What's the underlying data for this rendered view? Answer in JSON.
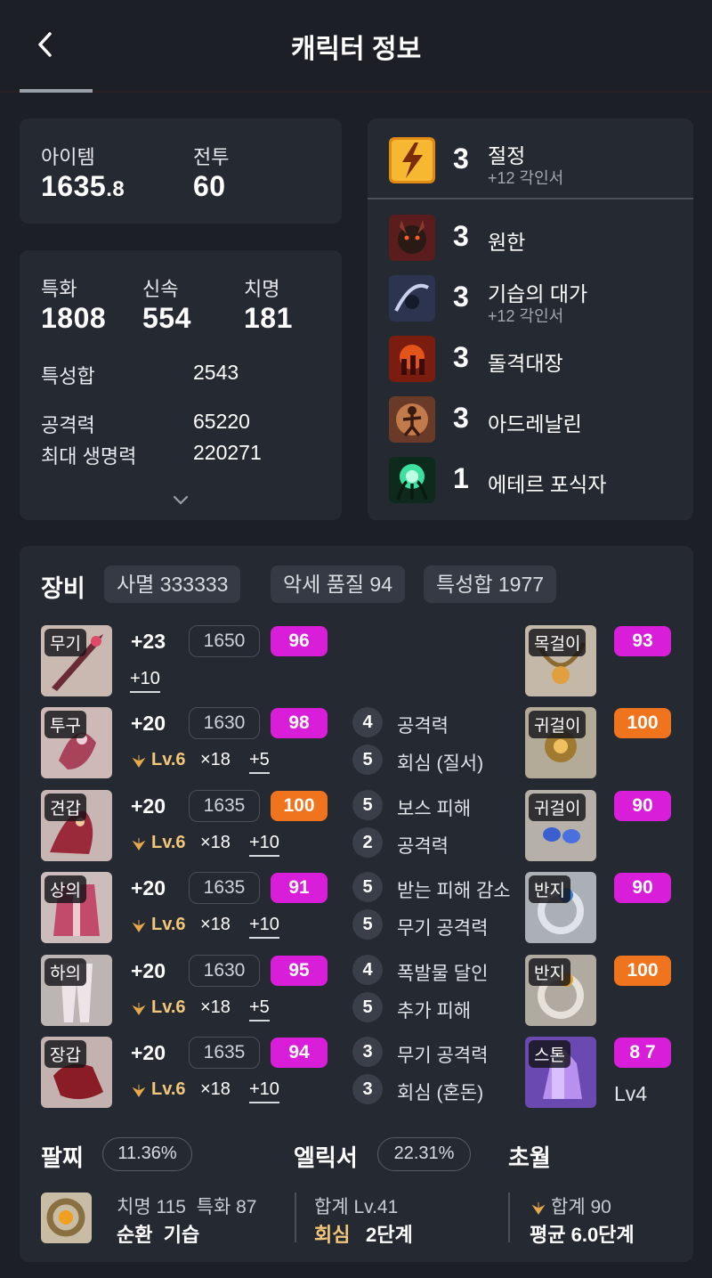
{
  "header": {
    "title": "캐릭터 정보"
  },
  "summary": {
    "item_label": "아이템",
    "item_level_main": "1635",
    "item_level_dec": ".8",
    "combat_label": "전투",
    "combat_level": "60"
  },
  "stats": {
    "crit_special": {
      "label": "특화",
      "value": "1808"
    },
    "swiftness": {
      "label": "신속",
      "value": "554"
    },
    "crit": {
      "label": "치명",
      "value": "181"
    },
    "total_label": "특성합",
    "total_value": "2543",
    "attack_label": "공격력",
    "attack_value": "65220",
    "hp_label": "최대 생명력",
    "hp_value": "220271"
  },
  "engravings": [
    {
      "level": "3",
      "name": "절정",
      "sub": "+12 각인서"
    },
    {
      "level": "3",
      "name": "원한",
      "sub": ""
    },
    {
      "level": "3",
      "name": "기습의 대가",
      "sub": "+12 각인서"
    },
    {
      "level": "3",
      "name": "돌격대장",
      "sub": ""
    },
    {
      "level": "3",
      "name": "아드레날린",
      "sub": ""
    },
    {
      "level": "1",
      "name": "에테르 포식자",
      "sub": ""
    }
  ],
  "equipment": {
    "title": "장비",
    "chips": [
      "사멸 333333",
      "악세 품질 94",
      "특성합 1977"
    ],
    "gear": [
      {
        "tag": "무기",
        "hone": "+23",
        "ilvl": "1650",
        "quality": "96",
        "lv": "",
        "mult": "",
        "plus": "+10"
      },
      {
        "tag": "투구",
        "hone": "+20",
        "ilvl": "1630",
        "quality": "98",
        "lv": "Lv.6",
        "mult": "×18",
        "plus": "+5"
      },
      {
        "tag": "견갑",
        "hone": "+20",
        "ilvl": "1635",
        "quality": "100",
        "lv": "Lv.6",
        "mult": "×18",
        "plus": "+10"
      },
      {
        "tag": "상의",
        "hone": "+20",
        "ilvl": "1635",
        "quality": "91",
        "lv": "Lv.6",
        "mult": "×18",
        "plus": "+10"
      },
      {
        "tag": "하의",
        "hone": "+20",
        "ilvl": "1630",
        "quality": "95",
        "lv": "Lv.6",
        "mult": "×18",
        "plus": "+5"
      },
      {
        "tag": "장갑",
        "hone": "+20",
        "ilvl": "1635",
        "quality": "94",
        "lv": "Lv.6",
        "mult": "×18",
        "plus": "+10"
      }
    ],
    "engrave_stats": [
      {
        "n": "4",
        "name": "공격력"
      },
      {
        "n": "5",
        "name": "회심 (질서)"
      },
      {
        "n": "5",
        "name": "보스 피해"
      },
      {
        "n": "2",
        "name": "공격력"
      },
      {
        "n": "5",
        "name": "받는 피해 감소"
      },
      {
        "n": "5",
        "name": "무기 공격력"
      },
      {
        "n": "4",
        "name": "폭발물 달인"
      },
      {
        "n": "5",
        "name": "추가 피해"
      },
      {
        "n": "3",
        "name": "무기 공격력"
      },
      {
        "n": "3",
        "name": "회심 (혼돈)"
      }
    ],
    "accessories": [
      {
        "tag": "목걸이",
        "quality": "93"
      },
      {
        "tag": "귀걸이",
        "quality": "100"
      },
      {
        "tag": "귀걸이",
        "quality": "90"
      },
      {
        "tag": "반지",
        "quality": "90"
      },
      {
        "tag": "반지",
        "quality": "100"
      },
      {
        "tag": "스톤",
        "quality": "8 7",
        "extra": "Lv4"
      }
    ]
  },
  "bottom": {
    "bracelet_label": "팔찌",
    "bracelet_pct": "11.36%",
    "elixir_label": "엘릭서",
    "elixir_pct": "22.31%",
    "transcend_label": "초월",
    "bracelet_stats": "치명 115  특화 87",
    "bracelet_effects": "순환  기습",
    "elixir_total": "합계 Lv.41",
    "elixir_opt1": "회심",
    "elixir_opt2": "2단계",
    "trans_total": "합계 90",
    "trans_avg": "평균 6.0단계"
  },
  "colors": {
    "bg": "#1c1f26",
    "card": "#252932",
    "purple": "#d91ed9",
    "orange": "#f0731e"
  }
}
